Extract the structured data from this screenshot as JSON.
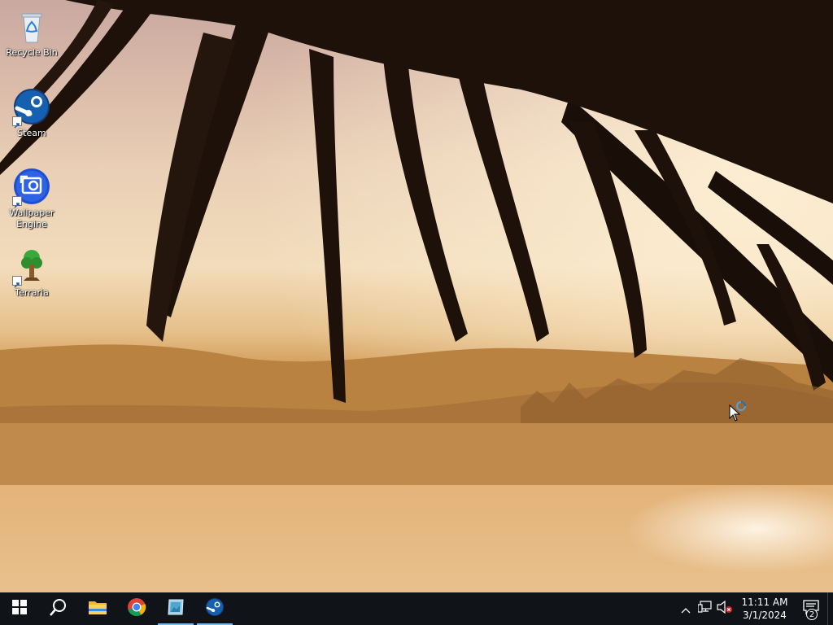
{
  "desktop": {
    "icons": [
      {
        "label": "Recycle Bin",
        "icon": "recycle-bin-icon"
      },
      {
        "label": "Steam",
        "icon": "steam-icon"
      },
      {
        "label": "Wallpaper Engine",
        "icon": "wallpaper-engine-icon"
      },
      {
        "label": "Terraria",
        "icon": "terraria-icon"
      }
    ]
  },
  "taskbar": {
    "pinned": [
      {
        "icon": "windows-start-icon"
      },
      {
        "icon": "search-icon"
      },
      {
        "icon": "file-explorer-icon"
      },
      {
        "icon": "chrome-icon"
      },
      {
        "icon": "wallpaper-app-icon"
      },
      {
        "icon": "steam-icon"
      }
    ],
    "accent_color": "#76b9ed"
  },
  "tray": {
    "icons": [
      "chevron-up-icon",
      "network-icon",
      "volume-muted-icon"
    ],
    "time": "11:11 AM",
    "date": "3/1/2024",
    "notification_count": "2"
  }
}
